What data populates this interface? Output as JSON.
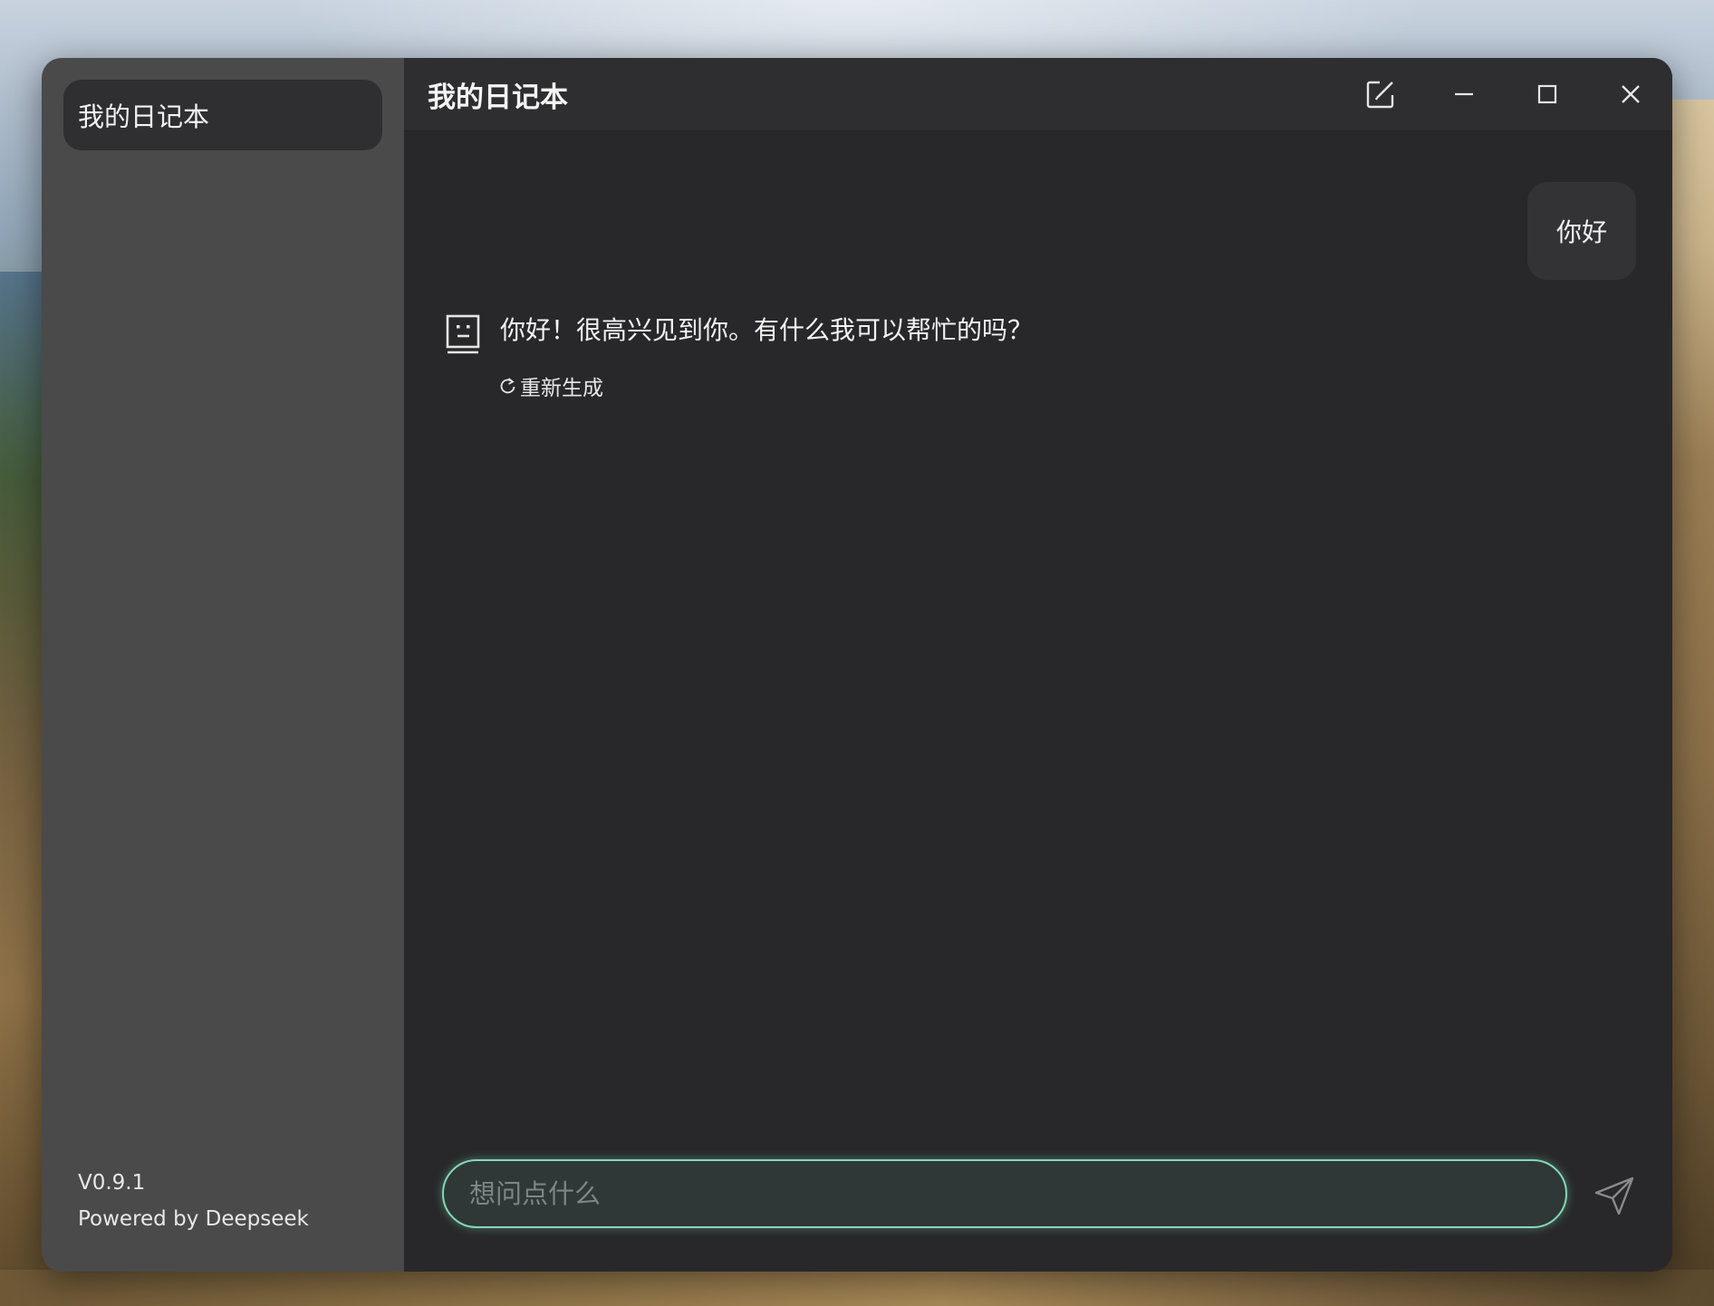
{
  "app": {
    "title": "我的日记本"
  },
  "sidebar": {
    "conversations": [
      {
        "label": "我的日记本"
      }
    ],
    "version": "V0.9.1",
    "powered_by": "Powered by Deepseek"
  },
  "titlebar": {
    "icons": [
      "edit-icon",
      "minimize-icon",
      "maximize-icon",
      "close-icon"
    ]
  },
  "chat": {
    "messages": [
      {
        "role": "user",
        "text": "你好"
      },
      {
        "role": "assistant",
        "text": "你好！很高兴见到你。有什么我可以帮忙的吗？"
      }
    ],
    "regenerate_label": "重新生成"
  },
  "input": {
    "placeholder": "想问点什么",
    "value": ""
  },
  "colors": {
    "sidebar_bg": "#4a4a4a",
    "main_bg": "#28282a",
    "accent": "#86d8b7"
  }
}
